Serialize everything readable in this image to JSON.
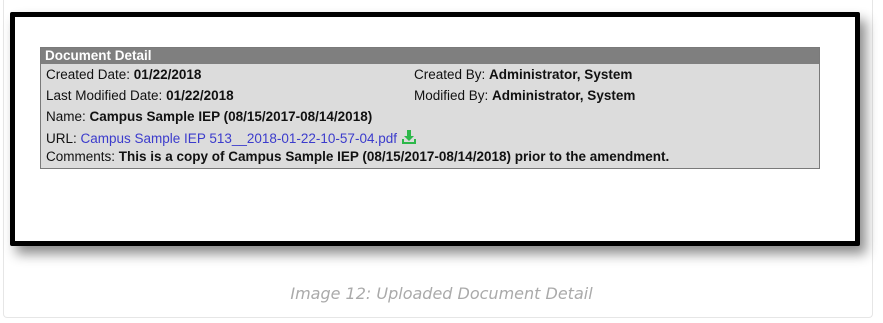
{
  "panel": {
    "title": "Document Detail",
    "created_date_label": "Created Date: ",
    "created_date": "01/22/2018",
    "created_by_label": "Created By: ",
    "created_by": "Administrator, System",
    "modified_date_label": "Last Modified Date: ",
    "modified_date": "01/22/2018",
    "modified_by_label": "Modified By: ",
    "modified_by": "Administrator, System",
    "name_label": "Name: ",
    "name": "Campus Sample IEP (08/15/2017-08/14/2018)",
    "url_label": "URL: ",
    "url_text": "Campus Sample IEP 513__2018-01-22-10-57-04.pdf",
    "download_icon": "download-arrow-icon",
    "comments_label": "Comments: ",
    "comments": "This is a copy of Campus Sample IEP (08/15/2017-08/14/2018) prior to the amendment."
  },
  "caption": "Image 12: Uploaded Document Detail",
  "colors": {
    "header_bg": "#7f7f7f",
    "panel_bg": "#dcdcdc",
    "link": "#3b3bcc",
    "download_icon": "#2db84a",
    "caption": "#aaaaaa"
  }
}
